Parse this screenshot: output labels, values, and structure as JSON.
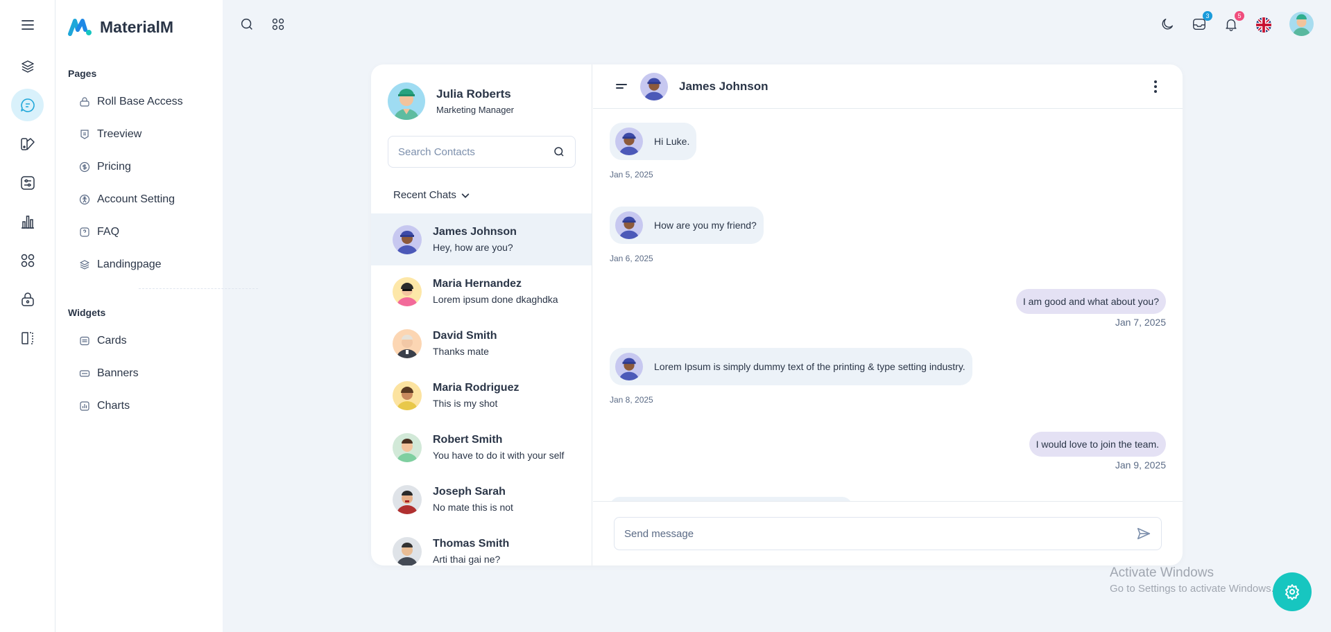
{
  "brand": {
    "name": "MaterialM"
  },
  "sidebar": {
    "sections": [
      {
        "title": "Pages"
      },
      {
        "title": "Widgets"
      }
    ],
    "pages": [
      {
        "label": "Roll Base Access",
        "icon": "lock-icon"
      },
      {
        "label": "Treeview",
        "icon": "tree-icon"
      },
      {
        "label": "Pricing",
        "icon": "dollar-icon"
      },
      {
        "label": "Account Setting",
        "icon": "accessibility-icon"
      },
      {
        "label": "FAQ",
        "icon": "question-icon"
      },
      {
        "label": "Landingpage",
        "icon": "layers-icon"
      }
    ],
    "widgets": [
      {
        "label": "Cards",
        "icon": "card-icon"
      },
      {
        "label": "Banners",
        "icon": "banner-icon"
      },
      {
        "label": "Charts",
        "icon": "chart-icon"
      }
    ]
  },
  "topbar": {
    "mail_badge": "3",
    "notif_badge": "5"
  },
  "profile": {
    "name": "Julia Roberts",
    "role": "Marketing Manager"
  },
  "search": {
    "placeholder": "Search Contacts"
  },
  "recent_label": "Recent Chats",
  "contacts": [
    {
      "name": "James Johnson",
      "msg": "Hey, how are you?"
    },
    {
      "name": "Maria Hernandez",
      "msg": "Lorem ipsum done dkaghdka"
    },
    {
      "name": "David Smith",
      "msg": "Thanks mate"
    },
    {
      "name": "Maria Rodriguez",
      "msg": "This is my shot"
    },
    {
      "name": "Robert Smith",
      "msg": "You have to do it with your self"
    },
    {
      "name": "Joseph Sarah",
      "msg": "No mate this is not"
    },
    {
      "name": "Thomas Smith",
      "msg": "Arti thai gai ne?"
    }
  ],
  "conversation": {
    "name": "James Johnson",
    "messages": [
      {
        "text": "Hi Luke.",
        "date": "Jan 5, 2025"
      },
      {
        "text": "How are you my friend?",
        "date": "Jan 6, 2025"
      },
      {
        "text": "I am good and what about you?",
        "date": "Jan 7, 2025"
      },
      {
        "text": "Lorem Ipsum is simply dummy text of the printing & type setting industry.",
        "date": "Jan 8, 2025"
      },
      {
        "text": "I would love to join the team.",
        "date": "Jan 9, 2025"
      }
    ]
  },
  "composer": {
    "placeholder": "Send message"
  },
  "watermark": {
    "line1": "Activate Windows",
    "line2": "Go to Settings to activate Windows."
  },
  "colors": {
    "accent": "#1fa7d9",
    "fab": "#17c6c0",
    "incoming_bubble": "#ecf2f8",
    "outgoing_bubble": "#e4e1f4",
    "mail_badge": "#1a9bdb",
    "notif_badge": "#f04d7d"
  }
}
